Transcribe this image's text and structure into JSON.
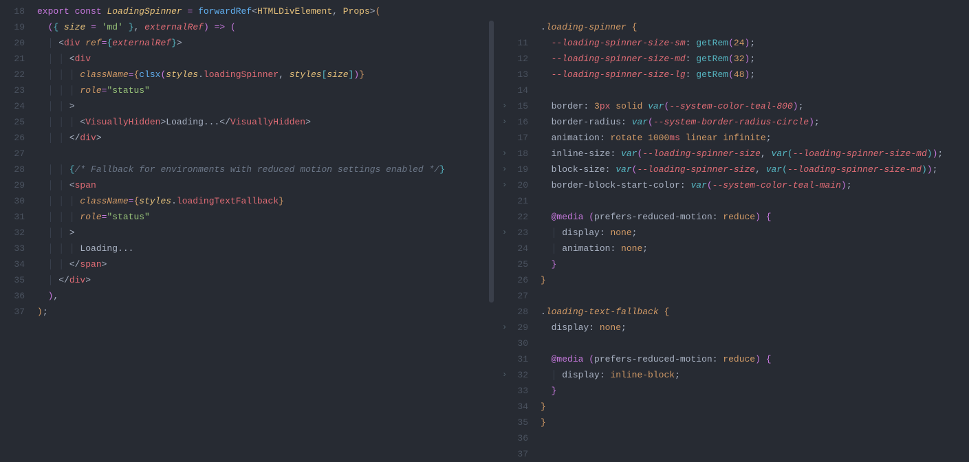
{
  "left": {
    "startLine": 18,
    "lines": [
      [
        {
          "c": "kw",
          "t": "export"
        },
        {
          "c": "punc",
          "t": " "
        },
        {
          "c": "kw",
          "t": "const"
        },
        {
          "c": "punc",
          "t": " "
        },
        {
          "c": "type",
          "t": "LoadingSpinner",
          "i": true
        },
        {
          "c": "punc",
          "t": " "
        },
        {
          "c": "kw",
          "t": "="
        },
        {
          "c": "punc",
          "t": " "
        },
        {
          "c": "fn",
          "t": "forwardRef"
        },
        {
          "c": "punc",
          "t": "<"
        },
        {
          "c": "type",
          "t": "HTMLDivElement"
        },
        {
          "c": "punc",
          "t": ", "
        },
        {
          "c": "type",
          "t": "Props"
        },
        {
          "c": "punc",
          "t": ">"
        },
        {
          "c": "bracket1",
          "t": "("
        }
      ],
      [
        {
          "c": "punc",
          "t": "  "
        },
        {
          "c": "bracket2",
          "t": "("
        },
        {
          "c": "bracket3",
          "t": "{"
        },
        {
          "c": "punc",
          "t": " "
        },
        {
          "c": "var",
          "t": "size"
        },
        {
          "c": "punc",
          "t": " "
        },
        {
          "c": "kw",
          "t": "="
        },
        {
          "c": "punc",
          "t": " "
        },
        {
          "c": "str",
          "t": "'md'"
        },
        {
          "c": "punc",
          "t": " "
        },
        {
          "c": "bracket3",
          "t": "}"
        },
        {
          "c": "punc",
          "t": ", "
        },
        {
          "c": "param",
          "t": "externalRef"
        },
        {
          "c": "bracket2",
          "t": ")"
        },
        {
          "c": "punc",
          "t": " "
        },
        {
          "c": "kw",
          "t": "=>"
        },
        {
          "c": "punc",
          "t": " "
        },
        {
          "c": "bracket2",
          "t": "("
        }
      ],
      [
        {
          "c": "guide",
          "t": "  │ "
        },
        {
          "c": "punc",
          "t": "<"
        },
        {
          "c": "tag",
          "t": "div"
        },
        {
          "c": "punc",
          "t": " "
        },
        {
          "c": "attr",
          "t": "ref"
        },
        {
          "c": "kw",
          "t": "="
        },
        {
          "c": "bracket3",
          "t": "{"
        },
        {
          "c": "param",
          "t": "externalRef"
        },
        {
          "c": "bracket3",
          "t": "}"
        },
        {
          "c": "punc",
          "t": ">"
        }
      ],
      [
        {
          "c": "guide",
          "t": "  │ │ "
        },
        {
          "c": "punc",
          "t": "<"
        },
        {
          "c": "tag",
          "t": "div"
        }
      ],
      [
        {
          "c": "guide",
          "t": "  │ │ │ "
        },
        {
          "c": "attr",
          "t": "className"
        },
        {
          "c": "kw",
          "t": "="
        },
        {
          "c": "bracket1",
          "t": "{"
        },
        {
          "c": "fn",
          "t": "clsx"
        },
        {
          "c": "bracket2",
          "t": "("
        },
        {
          "c": "obj",
          "t": "styles"
        },
        {
          "c": "punc",
          "t": "."
        },
        {
          "c": "prop",
          "t": "loadingSpinner"
        },
        {
          "c": "punc",
          "t": ", "
        },
        {
          "c": "obj",
          "t": "styles"
        },
        {
          "c": "bracket3",
          "t": "["
        },
        {
          "c": "var",
          "t": "size"
        },
        {
          "c": "bracket3",
          "t": "]"
        },
        {
          "c": "bracket2",
          "t": ")"
        },
        {
          "c": "bracket1",
          "t": "}"
        }
      ],
      [
        {
          "c": "guide",
          "t": "  │ │ │ "
        },
        {
          "c": "attr",
          "t": "role"
        },
        {
          "c": "kw",
          "t": "="
        },
        {
          "c": "str",
          "t": "\"status\""
        }
      ],
      [
        {
          "c": "guide",
          "t": "  │ │ "
        },
        {
          "c": "punc",
          "t": ">"
        }
      ],
      [
        {
          "c": "guide",
          "t": "  │ │ │ "
        },
        {
          "c": "punc",
          "t": "<"
        },
        {
          "c": "tag",
          "t": "VisuallyHidden"
        },
        {
          "c": "punc",
          "t": ">"
        },
        {
          "c": "text",
          "t": "Loading..."
        },
        {
          "c": "punc",
          "t": "</"
        },
        {
          "c": "tag",
          "t": "VisuallyHidden"
        },
        {
          "c": "punc",
          "t": ">"
        }
      ],
      [
        {
          "c": "guide",
          "t": "  │ │ "
        },
        {
          "c": "punc",
          "t": "</"
        },
        {
          "c": "tag",
          "t": "div"
        },
        {
          "c": "punc",
          "t": ">"
        }
      ],
      [
        {
          "c": "text",
          "t": ""
        }
      ],
      [
        {
          "c": "guide",
          "t": "  │ │ "
        },
        {
          "c": "bracket3",
          "t": "{"
        },
        {
          "c": "comment",
          "t": "/* Fallback for environments with reduced motion settings enabled */"
        },
        {
          "c": "bracket3",
          "t": "}"
        }
      ],
      [
        {
          "c": "guide",
          "t": "  │ │ "
        },
        {
          "c": "punc",
          "t": "<"
        },
        {
          "c": "tag",
          "t": "span"
        }
      ],
      [
        {
          "c": "guide",
          "t": "  │ │ │ "
        },
        {
          "c": "attr",
          "t": "className"
        },
        {
          "c": "kw",
          "t": "="
        },
        {
          "c": "bracket1",
          "t": "{"
        },
        {
          "c": "obj",
          "t": "styles"
        },
        {
          "c": "punc",
          "t": "."
        },
        {
          "c": "prop",
          "t": "loadingTextFallback"
        },
        {
          "c": "bracket1",
          "t": "}"
        }
      ],
      [
        {
          "c": "guide",
          "t": "  │ │ │ "
        },
        {
          "c": "attr",
          "t": "role"
        },
        {
          "c": "kw",
          "t": "="
        },
        {
          "c": "str",
          "t": "\"status\""
        }
      ],
      [
        {
          "c": "guide",
          "t": "  │ │ "
        },
        {
          "c": "punc",
          "t": ">"
        }
      ],
      [
        {
          "c": "guide",
          "t": "  │ │ │ "
        },
        {
          "c": "text",
          "t": "Loading..."
        }
      ],
      [
        {
          "c": "guide",
          "t": "  │ │ "
        },
        {
          "c": "punc",
          "t": "</"
        },
        {
          "c": "tag",
          "t": "span"
        },
        {
          "c": "punc",
          "t": ">"
        }
      ],
      [
        {
          "c": "guide",
          "t": "  │ "
        },
        {
          "c": "punc",
          "t": "</"
        },
        {
          "c": "tag",
          "t": "div"
        },
        {
          "c": "punc",
          "t": ">"
        }
      ],
      [
        {
          "c": "punc",
          "t": "  "
        },
        {
          "c": "bracket2",
          "t": ")"
        },
        {
          "c": "punc",
          "t": ","
        }
      ],
      [
        {
          "c": "bracket1",
          "t": ")"
        },
        {
          "c": "punc",
          "t": ";"
        }
      ]
    ]
  },
  "right": {
    "startLine": 11,
    "markers": {
      "17": "›",
      "18": "›",
      "20": "›",
      "21": "›",
      "22": "›",
      "25": "›",
      "31": "›",
      "34": "›"
    },
    "lines": [
      [
        {
          "c": "text",
          "t": ""
        }
      ],
      [
        {
          "c": "punc",
          "t": "."
        },
        {
          "c": "sel",
          "t": "loading-spinner"
        },
        {
          "c": "punc",
          "t": " "
        },
        {
          "c": "bracket1",
          "t": "{"
        }
      ],
      [
        {
          "c": "guide",
          "t": "  "
        },
        {
          "c": "cvar",
          "t": "--loading-spinner-size-sm"
        },
        {
          "c": "punc",
          "t": ": "
        },
        {
          "c": "cfn",
          "t": "getRem"
        },
        {
          "c": "bracket2",
          "t": "("
        },
        {
          "c": "cnum",
          "t": "24"
        },
        {
          "c": "bracket2",
          "t": ")"
        },
        {
          "c": "punc",
          "t": ";"
        }
      ],
      [
        {
          "c": "guide",
          "t": "  "
        },
        {
          "c": "cvar",
          "t": "--loading-spinner-size-md"
        },
        {
          "c": "punc",
          "t": ": "
        },
        {
          "c": "cfn",
          "t": "getRem"
        },
        {
          "c": "bracket2",
          "t": "("
        },
        {
          "c": "cnum",
          "t": "32"
        },
        {
          "c": "bracket2",
          "t": ")"
        },
        {
          "c": "punc",
          "t": ";"
        }
      ],
      [
        {
          "c": "guide",
          "t": "  "
        },
        {
          "c": "cvar",
          "t": "--loading-spinner-size-lg"
        },
        {
          "c": "punc",
          "t": ": "
        },
        {
          "c": "cfn",
          "t": "getRem"
        },
        {
          "c": "bracket2",
          "t": "("
        },
        {
          "c": "cnum",
          "t": "48"
        },
        {
          "c": "bracket2",
          "t": ")"
        },
        {
          "c": "punc",
          "t": ";"
        }
      ],
      [
        {
          "c": "text",
          "t": ""
        }
      ],
      [
        {
          "c": "guide",
          "t": "  "
        },
        {
          "c": "cprop",
          "t": "border"
        },
        {
          "c": "punc",
          "t": ": "
        },
        {
          "c": "cnum",
          "t": "3"
        },
        {
          "c": "cunit",
          "t": "px"
        },
        {
          "c": "punc",
          "t": " "
        },
        {
          "c": "cval",
          "t": "solid"
        },
        {
          "c": "punc",
          "t": " "
        },
        {
          "c": "cfn",
          "t": "var",
          "i": true
        },
        {
          "c": "bracket2",
          "t": "("
        },
        {
          "c": "cvar",
          "t": "--system-color-teal-800"
        },
        {
          "c": "bracket2",
          "t": ")"
        },
        {
          "c": "punc",
          "t": ";"
        }
      ],
      [
        {
          "c": "guide",
          "t": "  "
        },
        {
          "c": "cprop",
          "t": "border-radius"
        },
        {
          "c": "punc",
          "t": ": "
        },
        {
          "c": "cfn",
          "t": "var",
          "i": true
        },
        {
          "c": "bracket2",
          "t": "("
        },
        {
          "c": "cvar",
          "t": "--system-border-radius-circle"
        },
        {
          "c": "bracket2",
          "t": ")"
        },
        {
          "c": "punc",
          "t": ";"
        }
      ],
      [
        {
          "c": "guide",
          "t": "  "
        },
        {
          "c": "cprop",
          "t": "animation"
        },
        {
          "c": "punc",
          "t": ": "
        },
        {
          "c": "cval",
          "t": "rotate"
        },
        {
          "c": "punc",
          "t": " "
        },
        {
          "c": "cnum",
          "t": "1000"
        },
        {
          "c": "cunit",
          "t": "ms"
        },
        {
          "c": "punc",
          "t": " "
        },
        {
          "c": "cval",
          "t": "linear"
        },
        {
          "c": "punc",
          "t": " "
        },
        {
          "c": "cval",
          "t": "infinite"
        },
        {
          "c": "punc",
          "t": ";"
        }
      ],
      [
        {
          "c": "guide",
          "t": "  "
        },
        {
          "c": "cprop",
          "t": "inline-size"
        },
        {
          "c": "punc",
          "t": ": "
        },
        {
          "c": "cfn",
          "t": "var",
          "i": true
        },
        {
          "c": "bracket2",
          "t": "("
        },
        {
          "c": "cvar",
          "t": "--loading-spinner-size"
        },
        {
          "c": "punc",
          "t": ", "
        },
        {
          "c": "cfn",
          "t": "var",
          "i": true
        },
        {
          "c": "bracket3",
          "t": "("
        },
        {
          "c": "cvar",
          "t": "--loading-spinner-size-md"
        },
        {
          "c": "bracket3",
          "t": ")"
        },
        {
          "c": "bracket2",
          "t": ")"
        },
        {
          "c": "punc",
          "t": ";"
        }
      ],
      [
        {
          "c": "guide",
          "t": "  "
        },
        {
          "c": "cprop",
          "t": "block-size"
        },
        {
          "c": "punc",
          "t": ": "
        },
        {
          "c": "cfn",
          "t": "var",
          "i": true
        },
        {
          "c": "bracket2",
          "t": "("
        },
        {
          "c": "cvar",
          "t": "--loading-spinner-size"
        },
        {
          "c": "punc",
          "t": ", "
        },
        {
          "c": "cfn",
          "t": "var",
          "i": true
        },
        {
          "c": "bracket3",
          "t": "("
        },
        {
          "c": "cvar",
          "t": "--loading-spinner-size-md"
        },
        {
          "c": "bracket3",
          "t": ")"
        },
        {
          "c": "bracket2",
          "t": ")"
        },
        {
          "c": "punc",
          "t": ";"
        }
      ],
      [
        {
          "c": "guide",
          "t": "  "
        },
        {
          "c": "cprop",
          "t": "border-block-start-color"
        },
        {
          "c": "punc",
          "t": ": "
        },
        {
          "c": "cfn",
          "t": "var",
          "i": true
        },
        {
          "c": "bracket2",
          "t": "("
        },
        {
          "c": "cvar",
          "t": "--system-color-teal-main"
        },
        {
          "c": "bracket2",
          "t": ")"
        },
        {
          "c": "punc",
          "t": ";"
        }
      ],
      [
        {
          "c": "text",
          "t": ""
        }
      ],
      [
        {
          "c": "guide",
          "t": "  "
        },
        {
          "c": "ckw",
          "t": "@media"
        },
        {
          "c": "punc",
          "t": " "
        },
        {
          "c": "bracket2",
          "t": "("
        },
        {
          "c": "cprop",
          "t": "prefers-reduced-motion"
        },
        {
          "c": "punc",
          "t": ": "
        },
        {
          "c": "cval",
          "t": "reduce"
        },
        {
          "c": "bracket2",
          "t": ")"
        },
        {
          "c": "punc",
          "t": " "
        },
        {
          "c": "bracket2",
          "t": "{"
        }
      ],
      [
        {
          "c": "guide",
          "t": "  │ "
        },
        {
          "c": "cprop",
          "t": "display"
        },
        {
          "c": "punc",
          "t": ": "
        },
        {
          "c": "cval",
          "t": "none"
        },
        {
          "c": "punc",
          "t": ";"
        }
      ],
      [
        {
          "c": "guide",
          "t": "  │ "
        },
        {
          "c": "cprop",
          "t": "animation"
        },
        {
          "c": "punc",
          "t": ": "
        },
        {
          "c": "cval",
          "t": "none"
        },
        {
          "c": "punc",
          "t": ";"
        }
      ],
      [
        {
          "c": "guide",
          "t": "  "
        },
        {
          "c": "bracket2",
          "t": "}"
        }
      ],
      [
        {
          "c": "bracket1",
          "t": "}"
        }
      ],
      [
        {
          "c": "text",
          "t": ""
        }
      ],
      [
        {
          "c": "punc",
          "t": "."
        },
        {
          "c": "sel",
          "t": "loading-text-fallback"
        },
        {
          "c": "punc",
          "t": " "
        },
        {
          "c": "bracket1",
          "t": "{"
        }
      ],
      [
        {
          "c": "guide",
          "t": "  "
        },
        {
          "c": "cprop",
          "t": "display"
        },
        {
          "c": "punc",
          "t": ": "
        },
        {
          "c": "cval",
          "t": "none"
        },
        {
          "c": "punc",
          "t": ";"
        }
      ],
      [
        {
          "c": "text",
          "t": ""
        }
      ],
      [
        {
          "c": "guide",
          "t": "  "
        },
        {
          "c": "ckw",
          "t": "@media"
        },
        {
          "c": "punc",
          "t": " "
        },
        {
          "c": "bracket2",
          "t": "("
        },
        {
          "c": "cprop",
          "t": "prefers-reduced-motion"
        },
        {
          "c": "punc",
          "t": ": "
        },
        {
          "c": "cval",
          "t": "reduce"
        },
        {
          "c": "bracket2",
          "t": ")"
        },
        {
          "c": "punc",
          "t": " "
        },
        {
          "c": "bracket2",
          "t": "{"
        }
      ],
      [
        {
          "c": "guide",
          "t": "  │ "
        },
        {
          "c": "cprop",
          "t": "display"
        },
        {
          "c": "punc",
          "t": ": "
        },
        {
          "c": "cval",
          "t": "inline-block"
        },
        {
          "c": "punc",
          "t": ";"
        }
      ],
      [
        {
          "c": "guide",
          "t": "  "
        },
        {
          "c": "bracket2",
          "t": "}"
        }
      ],
      [
        {
          "c": "bracket1",
          "t": "}"
        }
      ],
      [
        {
          "c": "bracket1",
          "t": "}"
        }
      ]
    ]
  }
}
